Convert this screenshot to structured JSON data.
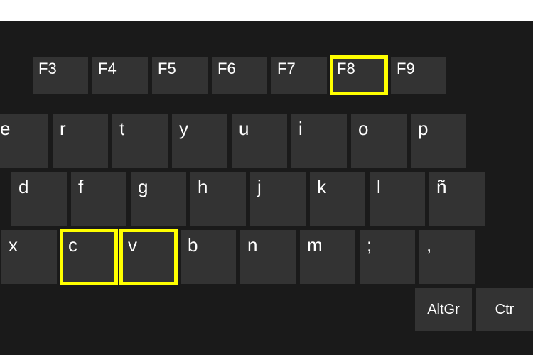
{
  "keyboard": {
    "highlight_color": "#ffff00",
    "rows": {
      "fn": [
        {
          "label": "F3",
          "highlighted": false
        },
        {
          "label": "F4",
          "highlighted": false
        },
        {
          "label": "F5",
          "highlighted": false
        },
        {
          "label": "F6",
          "highlighted": false
        },
        {
          "label": "F7",
          "highlighted": false
        },
        {
          "label": "F8",
          "highlighted": true
        },
        {
          "label": "F9",
          "highlighted": false
        }
      ],
      "top": [
        {
          "label": "e",
          "highlighted": false
        },
        {
          "label": "r",
          "highlighted": false
        },
        {
          "label": "t",
          "highlighted": false
        },
        {
          "label": "y",
          "highlighted": false
        },
        {
          "label": "u",
          "highlighted": false
        },
        {
          "label": "i",
          "highlighted": false
        },
        {
          "label": "o",
          "highlighted": false
        },
        {
          "label": "p",
          "highlighted": false
        }
      ],
      "home": [
        {
          "label": "d",
          "highlighted": false
        },
        {
          "label": "f",
          "highlighted": false
        },
        {
          "label": "g",
          "highlighted": false
        },
        {
          "label": "h",
          "highlighted": false
        },
        {
          "label": "j",
          "highlighted": false
        },
        {
          "label": "k",
          "highlighted": false
        },
        {
          "label": "l",
          "highlighted": false
        },
        {
          "label": "ñ",
          "highlighted": false
        }
      ],
      "bottom": [
        {
          "label": "x",
          "highlighted": false
        },
        {
          "label": "c",
          "highlighted": true
        },
        {
          "label": "v",
          "highlighted": true
        },
        {
          "label": "b",
          "highlighted": false
        },
        {
          "label": "n",
          "highlighted": false
        },
        {
          "label": "m",
          "highlighted": false
        },
        {
          "label": ";",
          "highlighted": false
        },
        {
          "label": ",",
          "highlighted": false
        }
      ],
      "mods": [
        {
          "label": "AltGr"
        },
        {
          "label": "Ctr"
        }
      ]
    }
  }
}
